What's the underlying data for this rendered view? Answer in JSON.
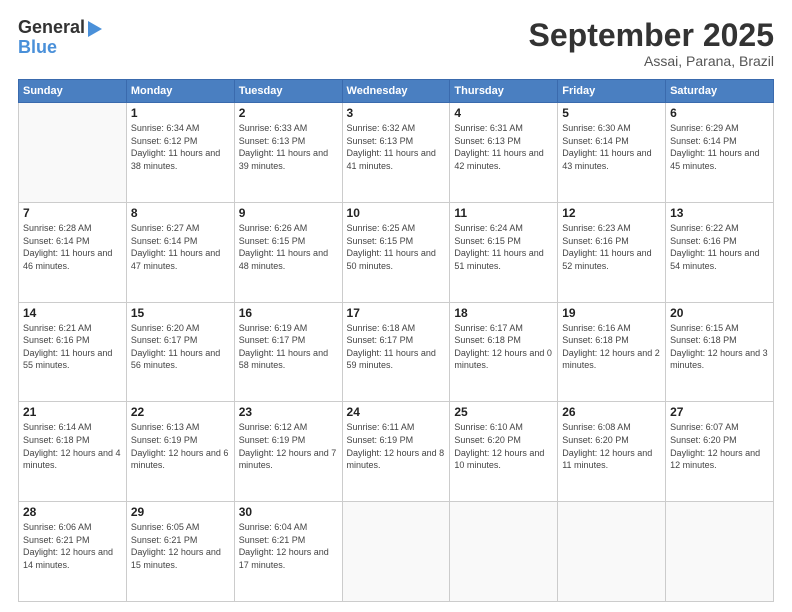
{
  "logo": {
    "general": "General",
    "blue": "Blue"
  },
  "header": {
    "month": "September 2025",
    "location": "Assai, Parana, Brazil"
  },
  "weekdays": [
    "Sunday",
    "Monday",
    "Tuesday",
    "Wednesday",
    "Thursday",
    "Friday",
    "Saturday"
  ],
  "days": [
    {
      "date": "",
      "sunrise": "",
      "sunset": "",
      "daylight": ""
    },
    {
      "date": "1",
      "sunrise": "Sunrise: 6:34 AM",
      "sunset": "Sunset: 6:12 PM",
      "daylight": "Daylight: 11 hours and 38 minutes."
    },
    {
      "date": "2",
      "sunrise": "Sunrise: 6:33 AM",
      "sunset": "Sunset: 6:13 PM",
      "daylight": "Daylight: 11 hours and 39 minutes."
    },
    {
      "date": "3",
      "sunrise": "Sunrise: 6:32 AM",
      "sunset": "Sunset: 6:13 PM",
      "daylight": "Daylight: 11 hours and 41 minutes."
    },
    {
      "date": "4",
      "sunrise": "Sunrise: 6:31 AM",
      "sunset": "Sunset: 6:13 PM",
      "daylight": "Daylight: 11 hours and 42 minutes."
    },
    {
      "date": "5",
      "sunrise": "Sunrise: 6:30 AM",
      "sunset": "Sunset: 6:14 PM",
      "daylight": "Daylight: 11 hours and 43 minutes."
    },
    {
      "date": "6",
      "sunrise": "Sunrise: 6:29 AM",
      "sunset": "Sunset: 6:14 PM",
      "daylight": "Daylight: 11 hours and 45 minutes."
    },
    {
      "date": "7",
      "sunrise": "Sunrise: 6:28 AM",
      "sunset": "Sunset: 6:14 PM",
      "daylight": "Daylight: 11 hours and 46 minutes."
    },
    {
      "date": "8",
      "sunrise": "Sunrise: 6:27 AM",
      "sunset": "Sunset: 6:14 PM",
      "daylight": "Daylight: 11 hours and 47 minutes."
    },
    {
      "date": "9",
      "sunrise": "Sunrise: 6:26 AM",
      "sunset": "Sunset: 6:15 PM",
      "daylight": "Daylight: 11 hours and 48 minutes."
    },
    {
      "date": "10",
      "sunrise": "Sunrise: 6:25 AM",
      "sunset": "Sunset: 6:15 PM",
      "daylight": "Daylight: 11 hours and 50 minutes."
    },
    {
      "date": "11",
      "sunrise": "Sunrise: 6:24 AM",
      "sunset": "Sunset: 6:15 PM",
      "daylight": "Daylight: 11 hours and 51 minutes."
    },
    {
      "date": "12",
      "sunrise": "Sunrise: 6:23 AM",
      "sunset": "Sunset: 6:16 PM",
      "daylight": "Daylight: 11 hours and 52 minutes."
    },
    {
      "date": "13",
      "sunrise": "Sunrise: 6:22 AM",
      "sunset": "Sunset: 6:16 PM",
      "daylight": "Daylight: 11 hours and 54 minutes."
    },
    {
      "date": "14",
      "sunrise": "Sunrise: 6:21 AM",
      "sunset": "Sunset: 6:16 PM",
      "daylight": "Daylight: 11 hours and 55 minutes."
    },
    {
      "date": "15",
      "sunrise": "Sunrise: 6:20 AM",
      "sunset": "Sunset: 6:17 PM",
      "daylight": "Daylight: 11 hours and 56 minutes."
    },
    {
      "date": "16",
      "sunrise": "Sunrise: 6:19 AM",
      "sunset": "Sunset: 6:17 PM",
      "daylight": "Daylight: 11 hours and 58 minutes."
    },
    {
      "date": "17",
      "sunrise": "Sunrise: 6:18 AM",
      "sunset": "Sunset: 6:17 PM",
      "daylight": "Daylight: 11 hours and 59 minutes."
    },
    {
      "date": "18",
      "sunrise": "Sunrise: 6:17 AM",
      "sunset": "Sunset: 6:18 PM",
      "daylight": "Daylight: 12 hours and 0 minutes."
    },
    {
      "date": "19",
      "sunrise": "Sunrise: 6:16 AM",
      "sunset": "Sunset: 6:18 PM",
      "daylight": "Daylight: 12 hours and 2 minutes."
    },
    {
      "date": "20",
      "sunrise": "Sunrise: 6:15 AM",
      "sunset": "Sunset: 6:18 PM",
      "daylight": "Daylight: 12 hours and 3 minutes."
    },
    {
      "date": "21",
      "sunrise": "Sunrise: 6:14 AM",
      "sunset": "Sunset: 6:18 PM",
      "daylight": "Daylight: 12 hours and 4 minutes."
    },
    {
      "date": "22",
      "sunrise": "Sunrise: 6:13 AM",
      "sunset": "Sunset: 6:19 PM",
      "daylight": "Daylight: 12 hours and 6 minutes."
    },
    {
      "date": "23",
      "sunrise": "Sunrise: 6:12 AM",
      "sunset": "Sunset: 6:19 PM",
      "daylight": "Daylight: 12 hours and 7 minutes."
    },
    {
      "date": "24",
      "sunrise": "Sunrise: 6:11 AM",
      "sunset": "Sunset: 6:19 PM",
      "daylight": "Daylight: 12 hours and 8 minutes."
    },
    {
      "date": "25",
      "sunrise": "Sunrise: 6:10 AM",
      "sunset": "Sunset: 6:20 PM",
      "daylight": "Daylight: 12 hours and 10 minutes."
    },
    {
      "date": "26",
      "sunrise": "Sunrise: 6:08 AM",
      "sunset": "Sunset: 6:20 PM",
      "daylight": "Daylight: 12 hours and 11 minutes."
    },
    {
      "date": "27",
      "sunrise": "Sunrise: 6:07 AM",
      "sunset": "Sunset: 6:20 PM",
      "daylight": "Daylight: 12 hours and 12 minutes."
    },
    {
      "date": "28",
      "sunrise": "Sunrise: 6:06 AM",
      "sunset": "Sunset: 6:21 PM",
      "daylight": "Daylight: 12 hours and 14 minutes."
    },
    {
      "date": "29",
      "sunrise": "Sunrise: 6:05 AM",
      "sunset": "Sunset: 6:21 PM",
      "daylight": "Daylight: 12 hours and 15 minutes."
    },
    {
      "date": "30",
      "sunrise": "Sunrise: 6:04 AM",
      "sunset": "Sunset: 6:21 PM",
      "daylight": "Daylight: 12 hours and 17 minutes."
    },
    {
      "date": "",
      "sunrise": "",
      "sunset": "",
      "daylight": ""
    },
    {
      "date": "",
      "sunrise": "",
      "sunset": "",
      "daylight": ""
    },
    {
      "date": "",
      "sunrise": "",
      "sunset": "",
      "daylight": ""
    },
    {
      "date": "",
      "sunrise": "",
      "sunset": "",
      "daylight": ""
    }
  ]
}
